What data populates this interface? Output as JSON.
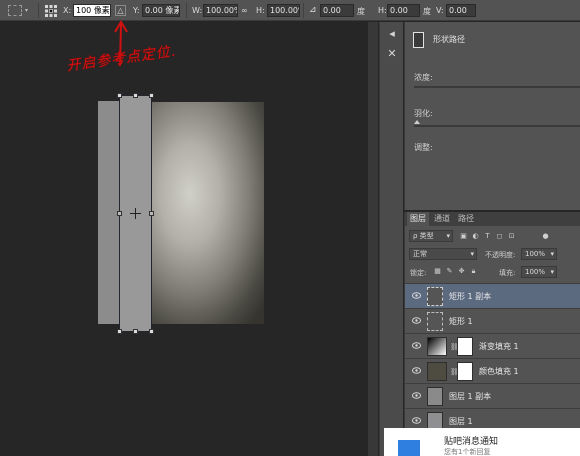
{
  "options_bar": {
    "x_label": "X:",
    "x_value": "100 像素",
    "y_label": "Y:",
    "y_value": "0.00 像素",
    "w_label": "W:",
    "w_value": "100.00%",
    "link_symbol": "∞",
    "h_label": "H:",
    "h_value": "100.00%",
    "angle_value": "0.00",
    "angle_unit": "度",
    "hskew_label": "H:",
    "hskew_value": "0.00",
    "hskew_unit": "度",
    "vskew_label": "V:",
    "vskew_value": "0.00"
  },
  "annotation": {
    "text": "开启参考点定位.",
    "color": "#d31010"
  },
  "properties": {
    "title": "形状路径",
    "density_label": "浓度:",
    "feather_label": "羽化:",
    "adjust_label": "调整:"
  },
  "layers_panel": {
    "tabs": [
      "图层",
      "通道",
      "路径"
    ],
    "kind_filter": "类型",
    "blend_mode": "正常",
    "opacity_label": "不透明度:",
    "opacity_value": "100%",
    "lock_label": "锁定:",
    "fill_label": "填充:",
    "fill_value": "100%",
    "layers": [
      {
        "name": "矩形 1 副本",
        "selected": true,
        "kind": "shape"
      },
      {
        "name": "矩形 1",
        "selected": false,
        "kind": "shape"
      },
      {
        "name": "渐变填充 1",
        "selected": false,
        "kind": "gradient-fill"
      },
      {
        "name": "颜色填充 1",
        "selected": false,
        "kind": "color-fill"
      },
      {
        "name": "图层 1 副本",
        "selected": false,
        "kind": "pixel"
      },
      {
        "name": "图层 1",
        "selected": false,
        "kind": "pixel"
      }
    ]
  },
  "notification": {
    "title": "贴吧消息通知",
    "subtitle": "您有1个新回复"
  },
  "colors": {
    "selection": "#5c6a80",
    "panel": "#535353",
    "canvas": "#262626",
    "annotation": "#d31010"
  }
}
